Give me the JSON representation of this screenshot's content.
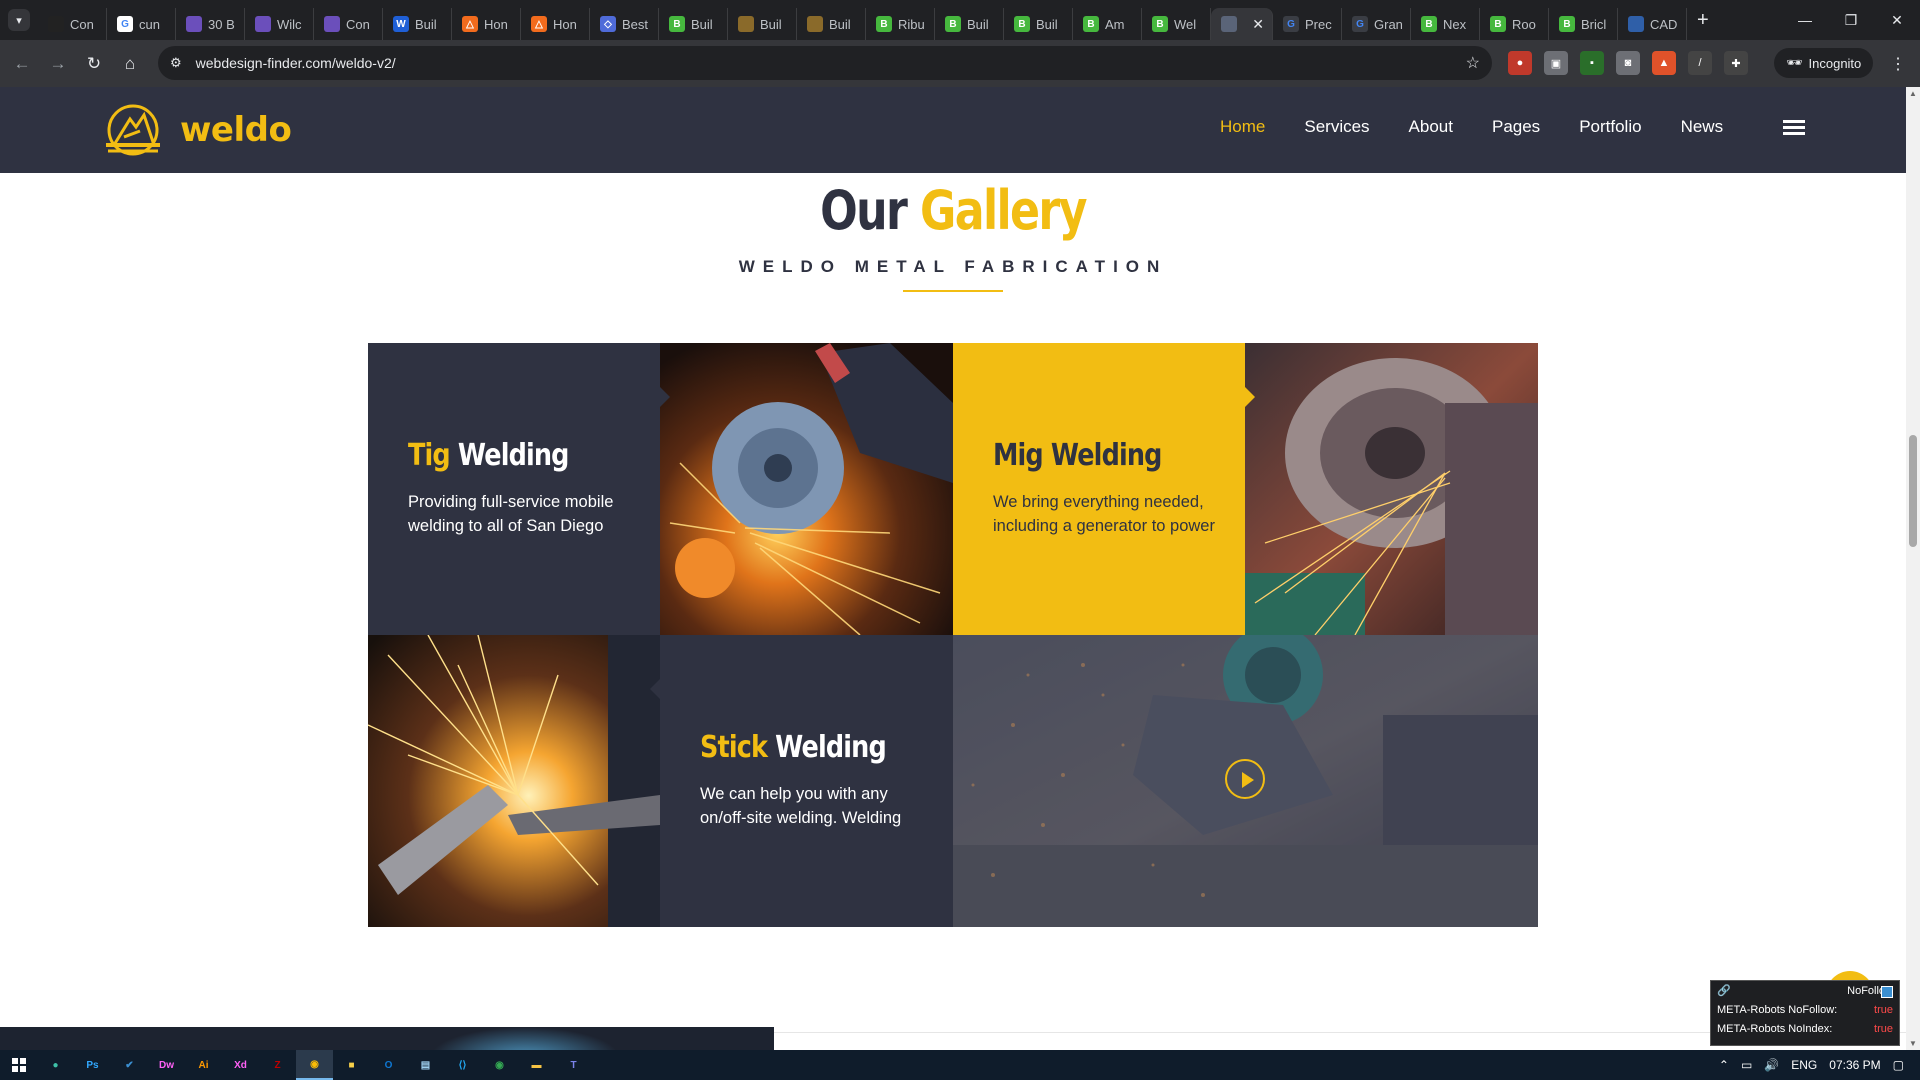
{
  "browser": {
    "tabs": [
      {
        "label": "Con",
        "fav_color": "#222222",
        "fav_glyph": ""
      },
      {
        "label": "cun",
        "fav_color": "#ffffff",
        "fav_glyph": "G"
      },
      {
        "label": "30 B",
        "fav_color": "#6b4fbb",
        "fav_glyph": ""
      },
      {
        "label": "Wilc",
        "fav_color": "#6b4fbb",
        "fav_glyph": ""
      },
      {
        "label": "Con",
        "fav_color": "#6b4fbb",
        "fav_glyph": ""
      },
      {
        "label": "Buil",
        "fav_color": "#1f5fd6",
        "fav_glyph": "W"
      },
      {
        "label": "Hon",
        "fav_color": "#f26b1d",
        "fav_glyph": "△"
      },
      {
        "label": "Hon",
        "fav_color": "#f26b1d",
        "fav_glyph": "△"
      },
      {
        "label": "Best",
        "fav_color": "#4f6bd9",
        "fav_glyph": "◇"
      },
      {
        "label": "Buil",
        "fav_color": "#46b83e",
        "fav_glyph": "B"
      },
      {
        "label": "Buil",
        "fav_color": "#8a6a2a",
        "fav_glyph": ""
      },
      {
        "label": "Buil",
        "fav_color": "#8a6a2a",
        "fav_glyph": ""
      },
      {
        "label": "Ribu",
        "fav_color": "#46b83e",
        "fav_glyph": "B"
      },
      {
        "label": "Buil",
        "fav_color": "#46b83e",
        "fav_glyph": "B"
      },
      {
        "label": "Buil",
        "fav_color": "#46b83e",
        "fav_glyph": "B"
      },
      {
        "label": "Am",
        "fav_color": "#46b83e",
        "fav_glyph": "B"
      },
      {
        "label": "Wel",
        "fav_color": "#46b83e",
        "fav_glyph": "B"
      },
      {
        "label": "",
        "fav_color": "#5a6478",
        "fav_glyph": ""
      },
      {
        "label": "Prec",
        "fav_color": "#3a3d44",
        "fav_glyph": "G"
      },
      {
        "label": "Gran",
        "fav_color": "#3a3d44",
        "fav_glyph": "G"
      },
      {
        "label": "Nex",
        "fav_color": "#46b83e",
        "fav_glyph": "B"
      },
      {
        "label": "Roo",
        "fav_color": "#46b83e",
        "fav_glyph": "B"
      },
      {
        "label": "Bricl",
        "fav_color": "#46b83e",
        "fav_glyph": "B"
      },
      {
        "label": "CAD",
        "fav_color": "#2f5fa8",
        "fav_glyph": ""
      }
    ],
    "active_tab_index": 17,
    "new_tab": "+",
    "url": "webdesign-finder.com/weldo-v2/",
    "incognito_label": "Incognito"
  },
  "site": {
    "logo_text": "weldo",
    "nav": [
      "Home",
      "Services",
      "About",
      "Pages",
      "Portfolio",
      "News"
    ],
    "active_nav": "Home",
    "colors": {
      "accent": "#f2bd13",
      "dark": "#2f3241"
    }
  },
  "gallery": {
    "title_a": "Our",
    "title_b": "Gallery",
    "subtitle": "WELDO METAL FABRICATION",
    "cards": [
      {
        "w1": "Tig",
        "w2": "Welding",
        "text": "Providing full-service mobile welding to all of San Diego"
      },
      {
        "w1": "Mig",
        "w2": "Welding",
        "text": "We bring everything needed, including a generator to power"
      },
      {
        "w1": "Stick",
        "w2": "Welding",
        "text": "We can help you with any on/off-site welding. Welding"
      }
    ],
    "images": [
      "angle-grinder-sparks",
      "lathe-sparks",
      "cutting-sparks",
      "cut-off-saw-video"
    ]
  },
  "seo_panel": {
    "title": "NoFollow",
    "rows": [
      {
        "label": "META-Robots NoFollow:",
        "value": "true"
      },
      {
        "label": "META-Robots NoIndex:",
        "value": "true"
      }
    ]
  },
  "taskbar": {
    "apps": [
      "windows",
      "edge",
      "Ps",
      "todo",
      "Dw",
      "Ai",
      "Xd",
      "filezilla",
      "chrome-active",
      "sticky",
      "outlook",
      "notepad",
      "vscode",
      "chrome",
      "explorer",
      "teams"
    ],
    "lang": "ENG",
    "time": "07:36 PM"
  }
}
